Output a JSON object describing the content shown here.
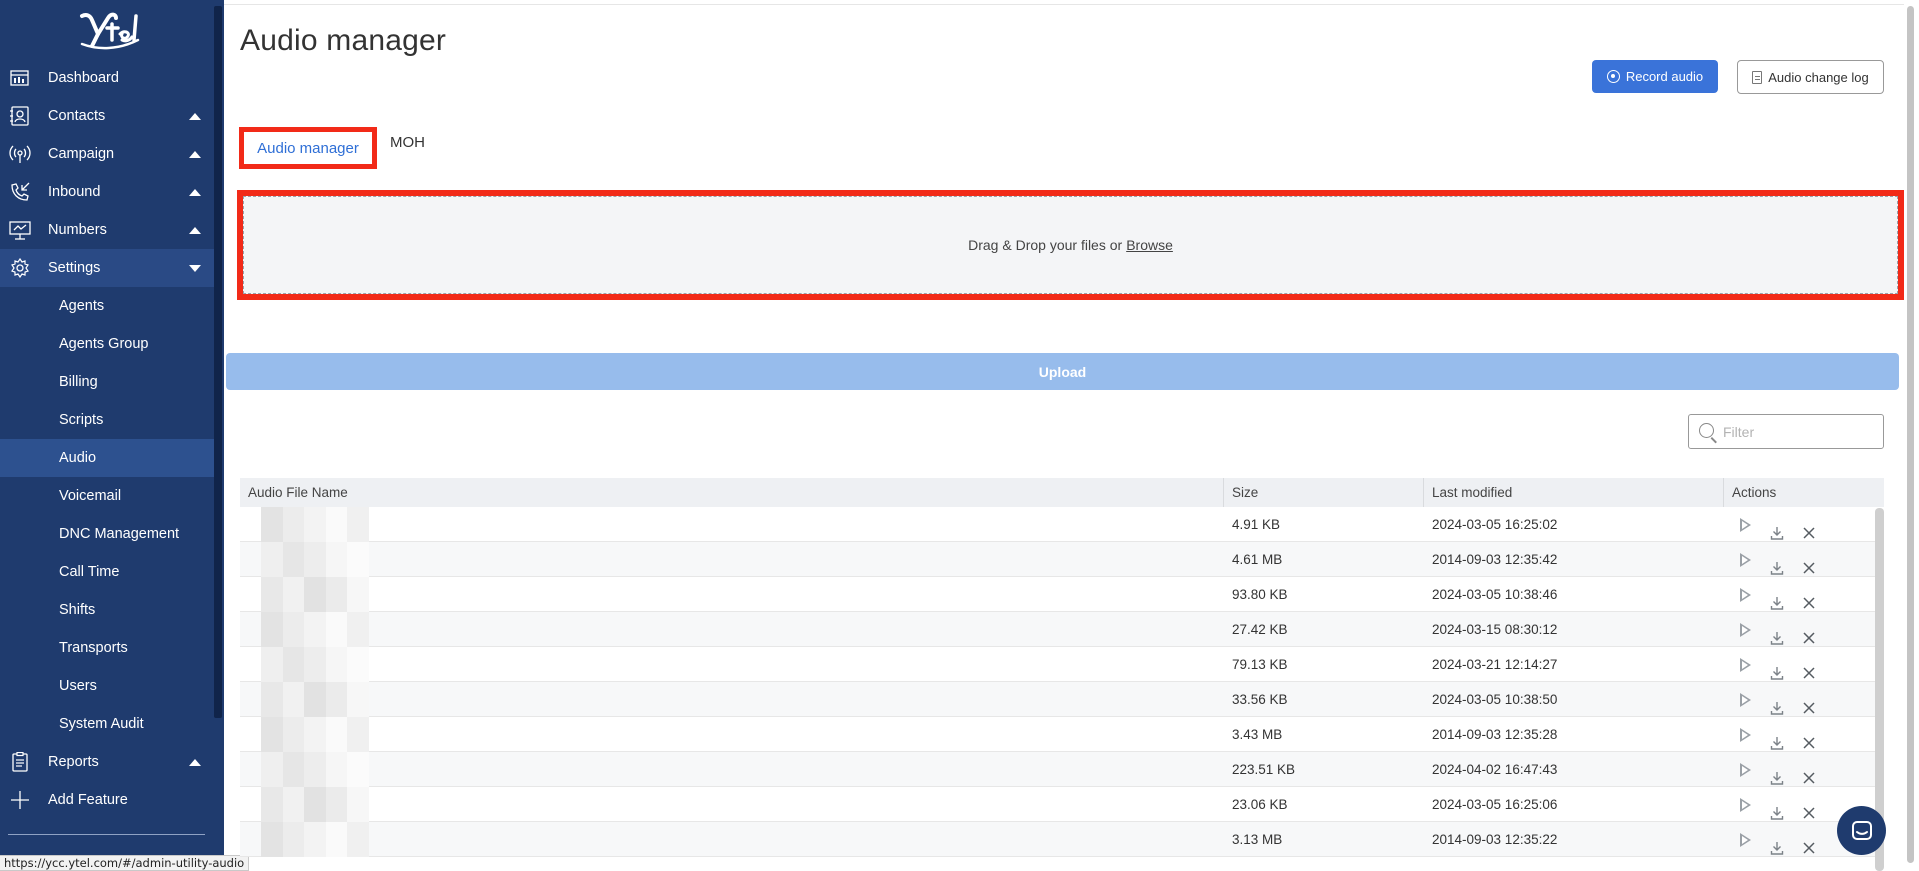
{
  "sidebar": {
    "logo_text": "Ytel",
    "items": [
      {
        "label": "Dashboard",
        "icon": "dashboard-icon"
      },
      {
        "label": "Contacts",
        "icon": "contacts-icon"
      },
      {
        "label": "Campaign",
        "icon": "campaign-icon"
      },
      {
        "label": "Inbound",
        "icon": "inbound-icon"
      },
      {
        "label": "Numbers",
        "icon": "numbers-icon"
      },
      {
        "label": "Settings",
        "icon": "gear-icon"
      }
    ],
    "settings_sub": [
      {
        "label": "Agents"
      },
      {
        "label": "Agents Group"
      },
      {
        "label": "Billing"
      },
      {
        "label": "Scripts"
      },
      {
        "label": "Audio"
      },
      {
        "label": "Voicemail"
      },
      {
        "label": "DNC Management"
      },
      {
        "label": "Call Time"
      },
      {
        "label": "Shifts"
      },
      {
        "label": "Transports"
      },
      {
        "label": "Users"
      },
      {
        "label": "System Audit"
      }
    ],
    "bottom_items": [
      {
        "label": "Reports",
        "icon": "reports-icon"
      },
      {
        "label": "Add Feature",
        "icon": "plus-icon"
      }
    ],
    "active_item": "Audio"
  },
  "status_bar": {
    "url": "https://ycc.ytel.com/#/admin-utility-audio"
  },
  "header": {
    "title": "Audio manager",
    "record_label": "Record audio",
    "changelog_label": "Audio change log"
  },
  "tabs": [
    {
      "label": "Audio manager",
      "active": true
    },
    {
      "label": "MOH",
      "active": false
    }
  ],
  "dropzone": {
    "text": "Drag & Drop your files or",
    "browse": "Browse"
  },
  "upload_label": "Upload",
  "filter": {
    "placeholder": "Filter",
    "value": ""
  },
  "table": {
    "columns": [
      "Audio File Name",
      "Size",
      "Last modified",
      "Actions"
    ],
    "rows": [
      {
        "name": "",
        "size": "4.91 KB",
        "modified": "2024-03-05 16:25:02"
      },
      {
        "name": "",
        "size": "4.61 MB",
        "modified": "2014-09-03 12:35:42"
      },
      {
        "name": "",
        "size": "93.80 KB",
        "modified": "2024-03-05 10:38:46"
      },
      {
        "name": "",
        "size": "27.42 KB",
        "modified": "2024-03-15 08:30:12"
      },
      {
        "name": "",
        "size": "79.13 KB",
        "modified": "2024-03-21 12:14:27"
      },
      {
        "name": "",
        "size": "33.56 KB",
        "modified": "2024-03-05 10:38:50"
      },
      {
        "name": "",
        "size": "3.43 MB",
        "modified": "2014-09-03 12:35:28"
      },
      {
        "name": "",
        "size": "223.51 KB",
        "modified": "2024-04-02 16:47:43"
      },
      {
        "name": "",
        "size": "23.06 KB",
        "modified": "2024-03-05 16:25:06"
      },
      {
        "name": "",
        "size": "3.13 MB",
        "modified": "2014-09-03 12:35:22"
      }
    ]
  },
  "colors": {
    "sidebar_bg": "#1f3b6e",
    "primary_button": "#3a73d9",
    "highlight_border": "#f22a18",
    "upload_button": "#97bcec",
    "active_tab_text": "#2f6fd6"
  }
}
